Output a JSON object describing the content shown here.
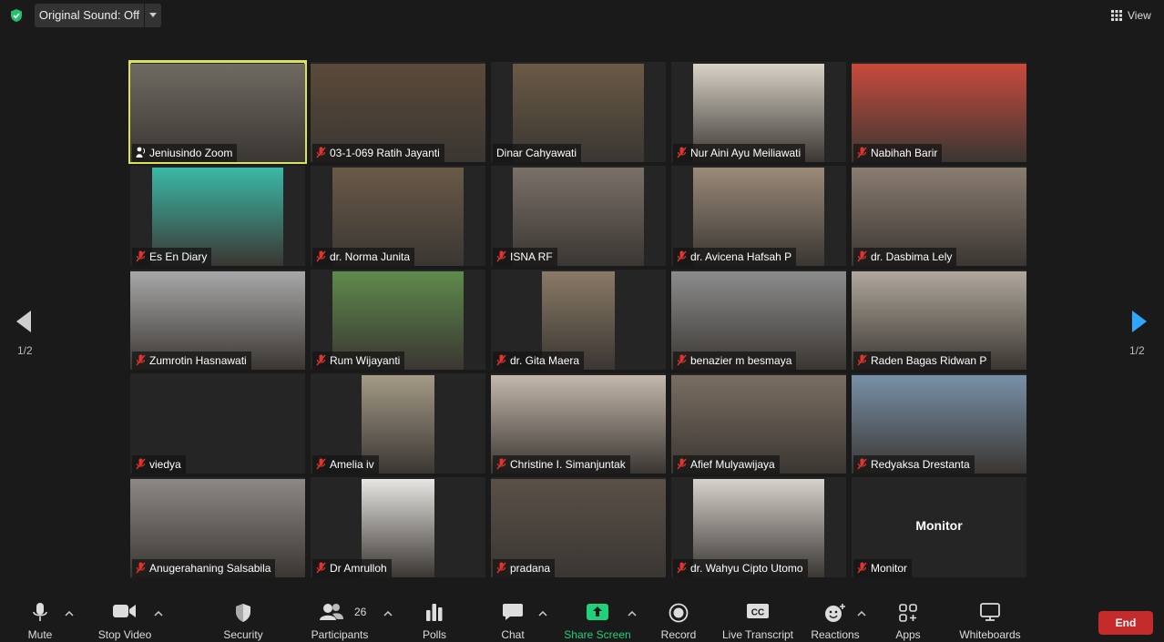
{
  "topbar": {
    "original_sound_label": "Original Sound: Off",
    "view_label": "View"
  },
  "navigation": {
    "page_left": "1/2",
    "page_right": "1/2"
  },
  "participants": [
    {
      "name": "Jeniusindo Zoom",
      "video_color": "#6f6a62",
      "active": true,
      "muted": false
    },
    {
      "name": "03-1-069 Ratih Jayanti",
      "video_color": "#5b4a3a",
      "muted": true
    },
    {
      "name": "Dinar Cahyawati",
      "video_color": "#6b5a45",
      "muted": false
    },
    {
      "name": "Nur Aini Ayu Meiliawati",
      "video_color": "#d9d3c7",
      "muted": true
    },
    {
      "name": "Nabihah Barir",
      "video_color": "#c94a3c",
      "muted": true
    },
    {
      "name": "Es En Diary",
      "video_color": "#3bb9a7",
      "muted": true
    },
    {
      "name": "dr. Norma Junita",
      "video_color": "#6a5a48",
      "muted": true
    },
    {
      "name": "ISNA RF",
      "video_color": "#7a7068",
      "muted": true
    },
    {
      "name": "dr. Avicena Hafsah P",
      "video_color": "#9a8a78",
      "muted": true
    },
    {
      "name": "dr. Dasbima Lely",
      "video_color": "#8a7c70",
      "muted": true
    },
    {
      "name": "Zumrotin Hasnawati",
      "video_color": "#a8a8a8",
      "muted": true
    },
    {
      "name": "Rum Wijayanti",
      "video_color": "#5e8a4c",
      "muted": true
    },
    {
      "name": "dr. Gita Maera",
      "video_color": "#8a7a66",
      "muted": true
    },
    {
      "name": "benazier m besmaya",
      "video_color": "#8c8c8c",
      "muted": true
    },
    {
      "name": "Raden Bagas Ridwan P",
      "video_color": "#b0a89c",
      "muted": true
    },
    {
      "name": "viedya",
      "video_color": "#252525",
      "muted": true
    },
    {
      "name": "Amelia iv",
      "video_color": "#a49a86",
      "muted": true
    },
    {
      "name": "Christine I. Simanjuntak",
      "video_color": "#c4b8ac",
      "muted": true
    },
    {
      "name": "Afief Mulyawijaya",
      "video_color": "#7a6e62",
      "muted": true
    },
    {
      "name": "Redyaksa Drestanta",
      "video_color": "#7890a8",
      "muted": true
    },
    {
      "name": "Anugerahaning Salsabila",
      "video_color": "#8c8884",
      "muted": true
    },
    {
      "name": "Dr Amrulloh",
      "video_color": "#e8e6e2",
      "muted": true
    },
    {
      "name": "pradana",
      "video_color": "#5a5048",
      "muted": true
    },
    {
      "name": "dr. Wahyu Cipto Utomo",
      "video_color": "#d6d2cc",
      "muted": true
    },
    {
      "name": "Monitor",
      "video_color": "#252525",
      "muted": true,
      "center_label": "Monitor"
    }
  ],
  "toolbar": {
    "mute": "Mute",
    "stop_video": "Stop Video",
    "security": "Security",
    "participants": "Participants",
    "participants_count": "26",
    "polls": "Polls",
    "chat": "Chat",
    "share_screen": "Share Screen",
    "record": "Record",
    "live_transcript": "Live Transcript",
    "reactions": "Reactions",
    "apps": "Apps",
    "whiteboards": "Whiteboards",
    "end": "End"
  },
  "colors": {
    "background": "#1a1a1a",
    "tile": "#252525",
    "active_border": "#d8e25b",
    "share_green": "#1fd17a",
    "end_red": "#c42b2b",
    "nav_blue": "#2ea7ff"
  }
}
